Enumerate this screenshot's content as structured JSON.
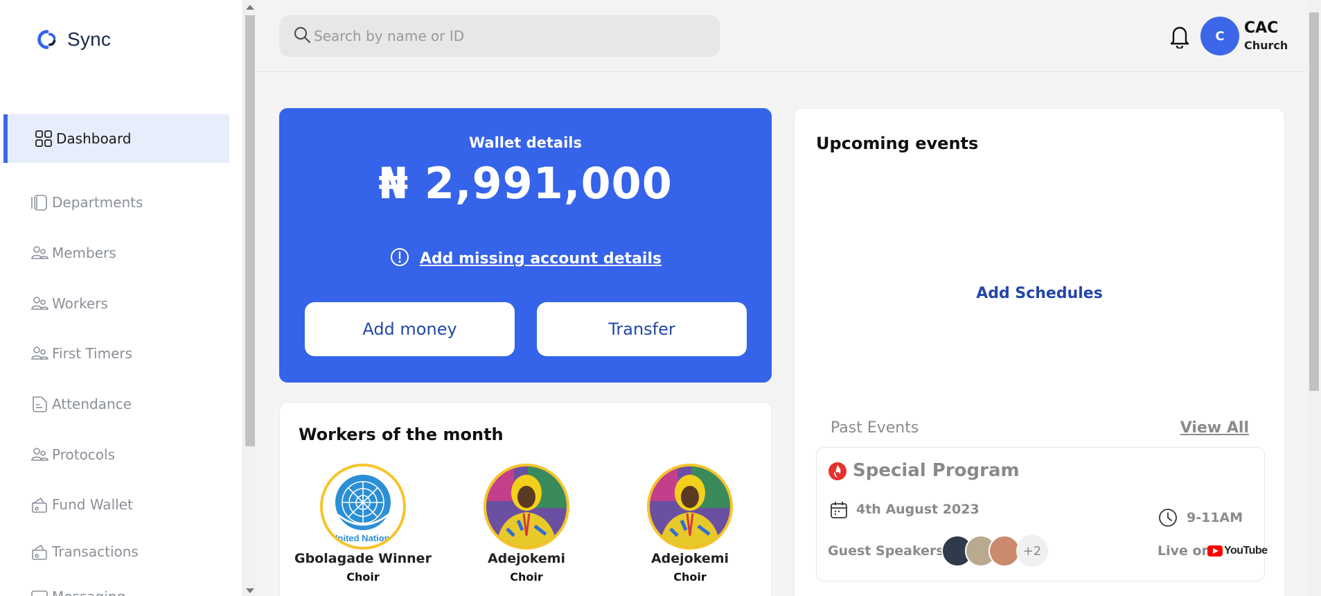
{
  "app": {
    "name": "Sync",
    "brand_color": "#3563e9"
  },
  "sidebar": {
    "items": [
      {
        "label": "Dashboard",
        "icon": "grid-icon",
        "active": true
      },
      {
        "label": "Departments",
        "icon": "departments-icon"
      },
      {
        "label": "Members",
        "icon": "users-icon"
      },
      {
        "label": "Workers",
        "icon": "users-icon"
      },
      {
        "label": "First Timers",
        "icon": "users-icon"
      },
      {
        "label": "Attendance",
        "icon": "document-icon"
      },
      {
        "label": "Protocols",
        "icon": "users-icon"
      },
      {
        "label": "Fund Wallet",
        "icon": "wallet-icon"
      },
      {
        "label": "Transactions",
        "icon": "wallet-icon"
      },
      {
        "label": "Messaging",
        "icon": "message-icon"
      }
    ]
  },
  "header": {
    "search_placeholder": "Search by name or ID",
    "avatar_initial": "C",
    "user_name": "CAC",
    "user_subtitle": "Church"
  },
  "wallet": {
    "title": "Wallet details",
    "amount": "₦ 2,991,000",
    "warning_link": "Add missing account details",
    "add_money_label": "Add money",
    "transfer_label": "Transfer"
  },
  "workers": {
    "title": "Workers of the month",
    "list": [
      {
        "name": "Gbolagade Winner",
        "role": "Choir",
        "photo": "un-logo",
        "photo_caption": "United Nations"
      },
      {
        "name": "Adejokemi",
        "role": "Choir",
        "photo": "portrait"
      },
      {
        "name": "Adejokemi",
        "role": "Choir",
        "photo": "portrait"
      }
    ]
  },
  "events": {
    "upcoming_title": "Upcoming events",
    "add_schedules_label": "Add Schedules",
    "past_label": "Past Events",
    "view_all_label": "View All",
    "past_event": {
      "title": "Special Program",
      "date": "4th August 2023",
      "time": "9-11AM",
      "speakers_label": "Guest Speakers",
      "extra_speakers": "+2",
      "live_label": "Live on",
      "platform": "YouTube"
    }
  }
}
